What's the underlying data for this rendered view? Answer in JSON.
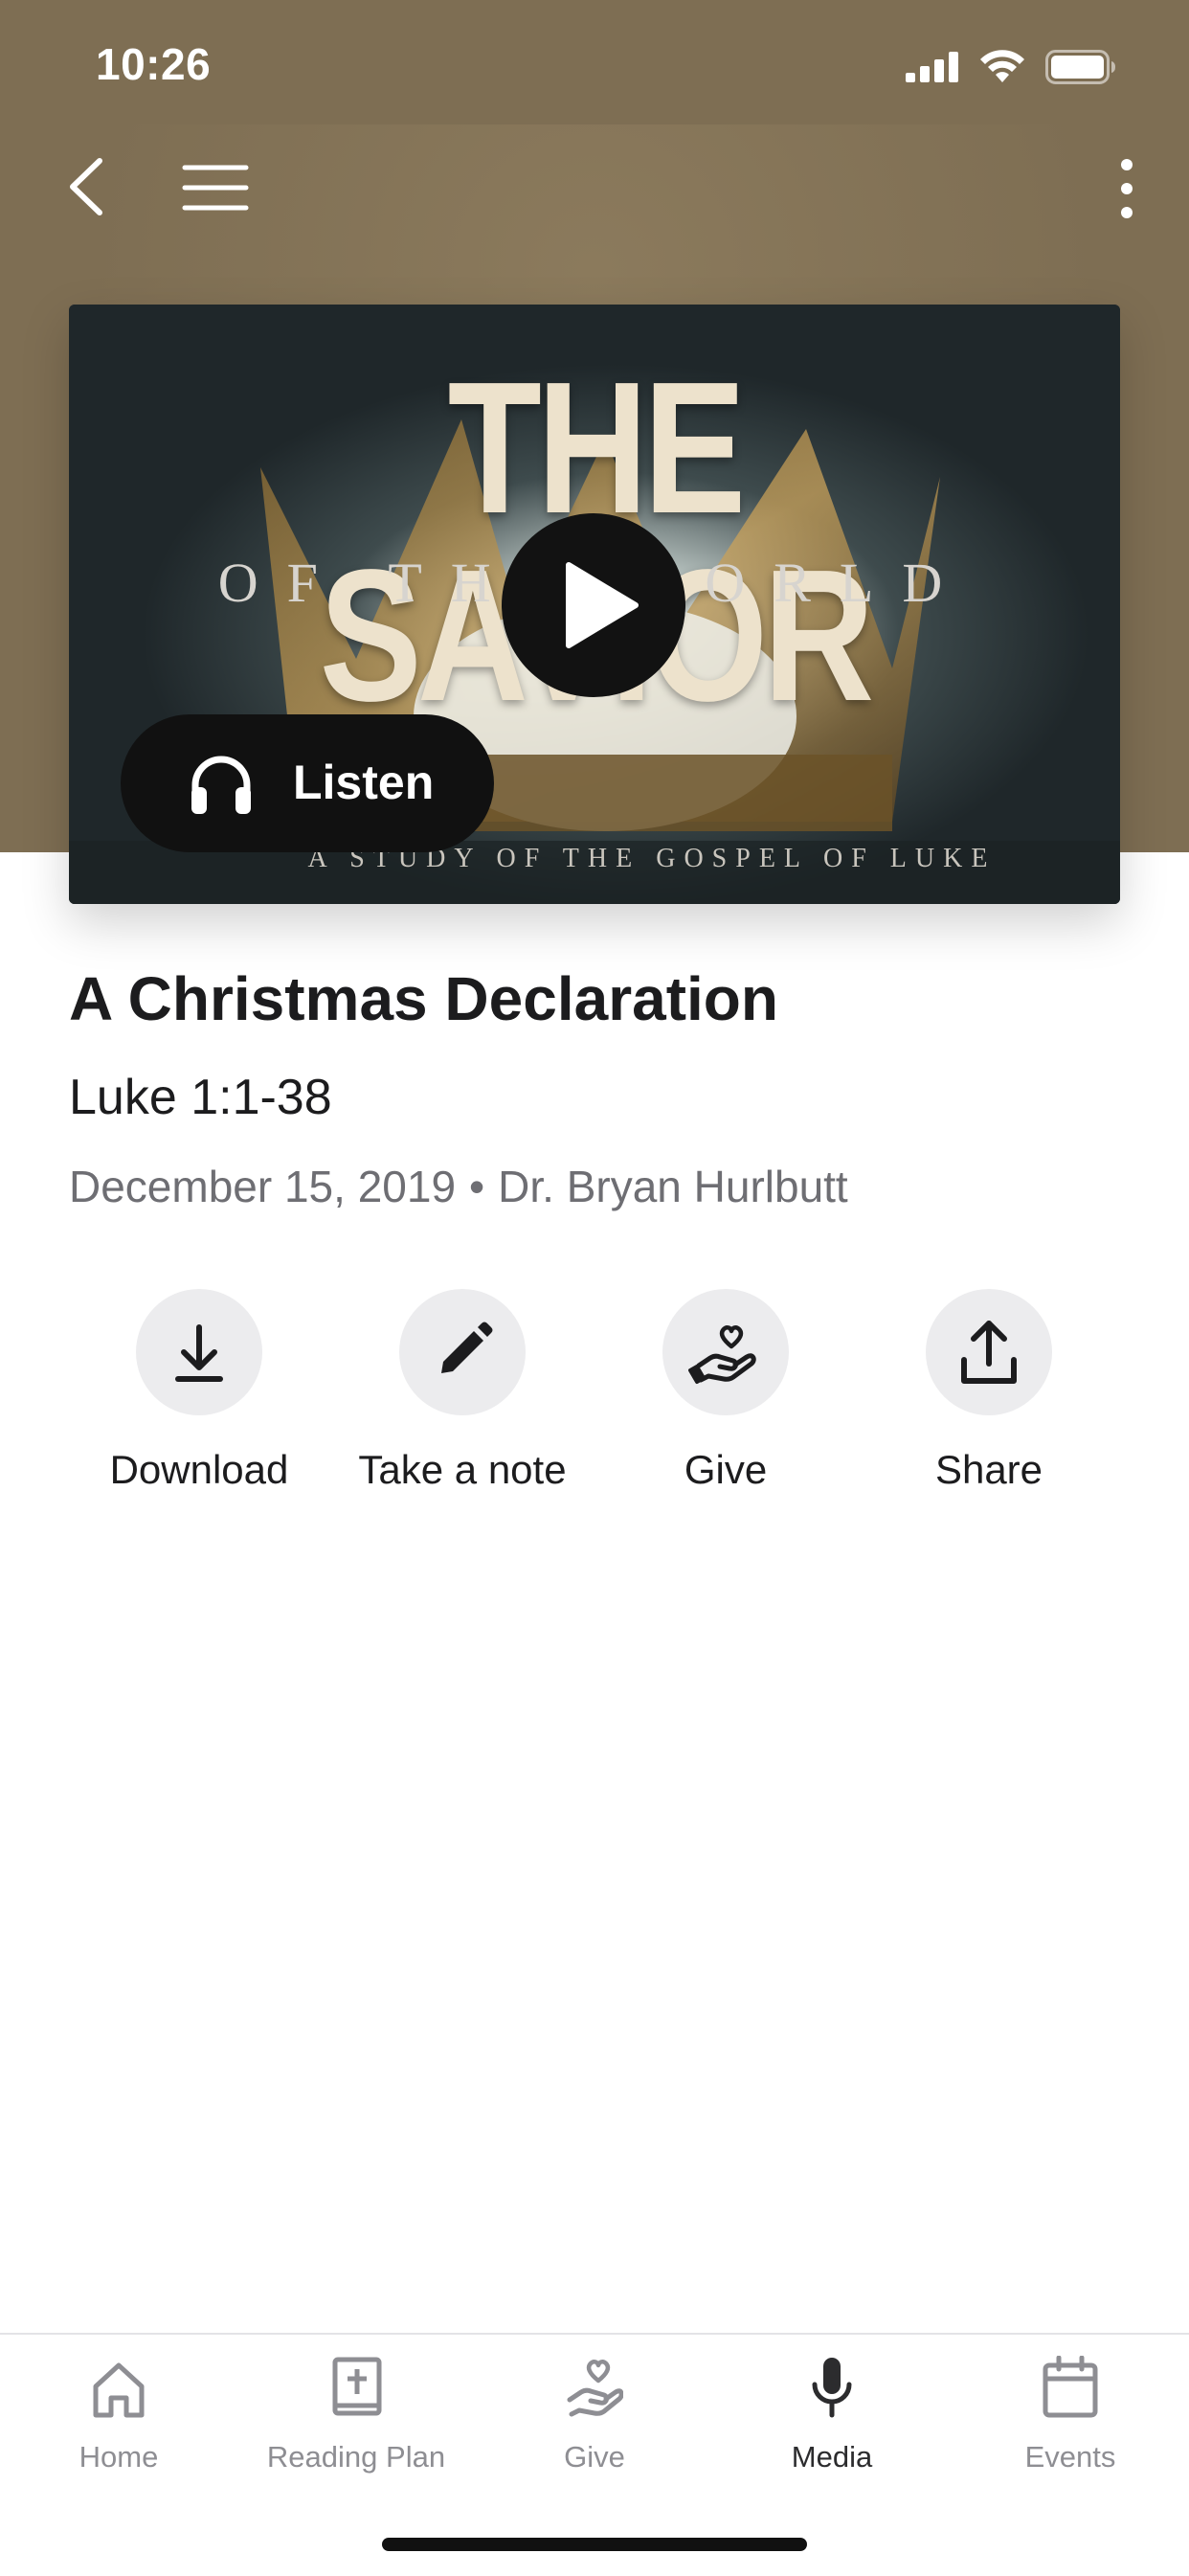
{
  "status_bar": {
    "time": "10:26"
  },
  "nav": {
    "back_icon": "chevron-left-icon",
    "menu_icon": "hamburger-menu-icon",
    "more_icon": "vertical-ellipsis-icon"
  },
  "artwork": {
    "title": "THE SAVIOR",
    "subtitle": "OF THE WORLD",
    "tagline": "A STUDY OF THE GOSPEL OF LUKE"
  },
  "player": {
    "play_icon": "play-icon",
    "listen_label": "Listen",
    "listen_icon": "headphones-icon"
  },
  "sermon": {
    "title": "A Christmas Declaration",
    "scripture": "Luke 1:1-38",
    "date": "December 15, 2019",
    "separator": "•",
    "speaker": "Dr. Bryan Hurlbutt"
  },
  "actions": [
    {
      "label": "Download",
      "icon": "download-icon"
    },
    {
      "label": "Take a note",
      "icon": "pencil-icon"
    },
    {
      "label": "Give",
      "icon": "heart-hand-icon"
    },
    {
      "label": "Share",
      "icon": "share-icon"
    }
  ],
  "tabs": [
    {
      "label": "Home",
      "icon": "home-icon",
      "active": false
    },
    {
      "label": "Reading Plan",
      "icon": "bible-icon",
      "active": false
    },
    {
      "label": "Give",
      "icon": "heart-hand-icon",
      "active": false
    },
    {
      "label": "Media",
      "icon": "microphone-icon",
      "active": true
    },
    {
      "label": "Events",
      "icon": "calendar-icon",
      "active": false
    }
  ],
  "colors": {
    "header_background": "#7e6e53",
    "active_tab": "#2c2c2e",
    "inactive_tab": "#8e8e93",
    "action_circle": "#ececee"
  }
}
